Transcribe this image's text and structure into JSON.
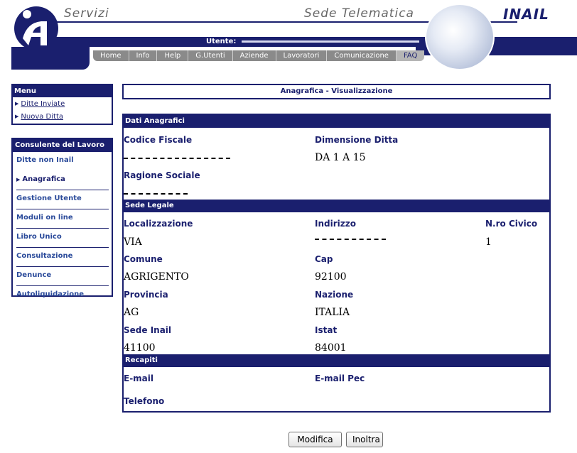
{
  "header": {
    "left_title": "Servizi",
    "right_title": "Sede Telematica",
    "brand": "INAIL",
    "user_label": "Utente:",
    "nav": [
      "Home",
      "Info",
      "Help",
      "G.Utenti",
      "Aziende",
      "Lavoratori",
      "Comunicazione",
      "FAQ"
    ]
  },
  "menu": {
    "title": "Menu",
    "items": [
      "Ditte Inviate",
      "Nuova Ditta"
    ]
  },
  "consulente": {
    "title": "Consulente del Lavoro",
    "items": [
      "Ditte non Inail",
      "Anagrafica",
      "Gestione Utente",
      "Moduli on line",
      "Libro Unico",
      "Consultazione",
      "Denunce",
      "Autoliquidazione"
    ],
    "active": "Anagrafica"
  },
  "page": {
    "title": "Anagrafica - Visualizzazione"
  },
  "dati_anagrafici": {
    "section": "Dati Anagrafici",
    "codice_fiscale_label": "Codice Fiscale",
    "dimensione_label": "Dimensione Ditta",
    "dimensione_value": "DA 1 A 15",
    "ragione_sociale_label": "Ragione Sociale"
  },
  "sede_legale": {
    "section": "Sede Legale",
    "localizzazione_label": "Localizzazione",
    "localizzazione_value": "VIA",
    "indirizzo_label": "Indirizzo",
    "civico_label": "N.ro Civico",
    "civico_value": "1",
    "comune_label": "Comune",
    "comune_value": "AGRIGENTO",
    "cap_label": "Cap",
    "cap_value": "92100",
    "provincia_label": "Provincia",
    "provincia_value": "AG",
    "nazione_label": "Nazione",
    "nazione_value": "ITALIA",
    "sede_inail_label": "Sede Inail",
    "sede_inail_value": "41100",
    "istat_label": "Istat",
    "istat_value": "84001"
  },
  "recapiti": {
    "section": "Recapiti",
    "email_label": "E-mail",
    "email_pec_label": "E-mail Pec",
    "telefono_label": "Telefono"
  },
  "buttons": {
    "modifica": "Modifica",
    "inoltra": "Inoltra"
  },
  "colors": {
    "primary": "#1a1f6e",
    "nav_bg": "#8a8a8a"
  }
}
